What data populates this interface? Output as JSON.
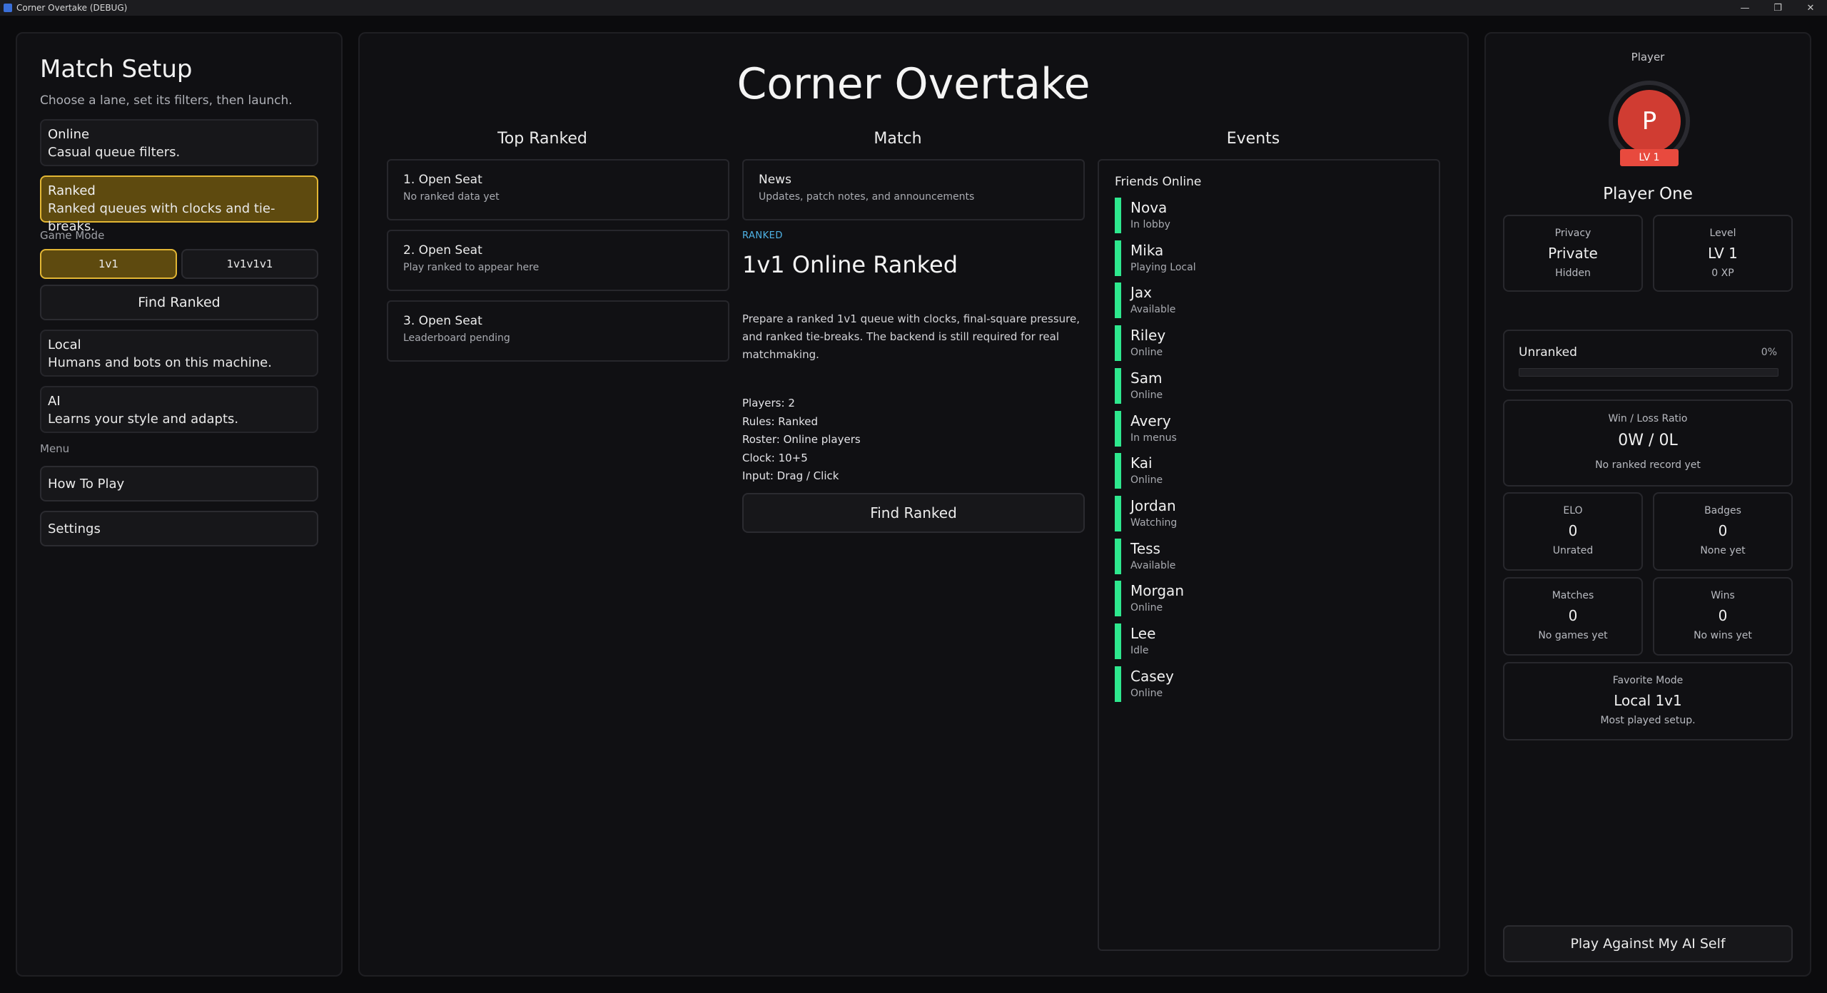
{
  "window": {
    "title": "Corner Overtake (DEBUG)",
    "min_glyph": "—",
    "max_glyph": "❐",
    "close_glyph": "✕"
  },
  "left": {
    "title": "Match Setup",
    "subtitle": "Choose a lane, set its filters, then launch.",
    "lanes": [
      {
        "name": "Online",
        "desc": "Casual queue filters."
      },
      {
        "name": "Ranked",
        "desc": "Ranked queues with clocks and tie-breaks."
      },
      {
        "name": "Local",
        "desc": "Humans and bots on this machine."
      },
      {
        "name": "AI",
        "desc": "Learns your style and adapts."
      }
    ],
    "game_mode_label": "Game Mode",
    "modes": [
      "1v1",
      "1v1v1v1"
    ],
    "selected_mode": "1v1",
    "find_button": "Find Ranked",
    "menu_label": "Menu",
    "menu": [
      "How To Play",
      "Settings"
    ]
  },
  "center": {
    "title": "Corner Overtake",
    "col_headers": [
      "Top Ranked",
      "Match",
      "Events"
    ],
    "top_ranked": [
      {
        "title": "1. Open Seat",
        "sub": "No ranked data yet"
      },
      {
        "title": "2. Open Seat",
        "sub": "Play ranked to appear here"
      },
      {
        "title": "3. Open Seat",
        "sub": "Leaderboard pending"
      }
    ],
    "news": {
      "title": "News",
      "sub": "Updates, patch notes, and announcements"
    },
    "match": {
      "tag": "RANKED",
      "title": "1v1 Online Ranked",
      "description": "Prepare a ranked 1v1 queue with clocks, final-square pressure, and ranked tie-breaks. The backend is still required for real matchmaking.",
      "players": "Players: 2",
      "rules": "Rules: Ranked",
      "roster": "Roster: Online players",
      "clock": "Clock: 10+5",
      "input": "Input: Drag / Click",
      "button": "Find Ranked"
    },
    "friends": {
      "header": "Friends Online",
      "status_color": "#2ee88e",
      "list": [
        {
          "name": "Nova",
          "status": "In lobby"
        },
        {
          "name": "Mika",
          "status": "Playing Local"
        },
        {
          "name": "Jax",
          "status": "Available"
        },
        {
          "name": "Riley",
          "status": "Online"
        },
        {
          "name": "Sam",
          "status": "Online"
        },
        {
          "name": "Avery",
          "status": "In menus"
        },
        {
          "name": "Kai",
          "status": "Online"
        },
        {
          "name": "Jordan",
          "status": "Watching"
        },
        {
          "name": "Tess",
          "status": "Available"
        },
        {
          "name": "Morgan",
          "status": "Online"
        },
        {
          "name": "Lee",
          "status": "Idle"
        },
        {
          "name": "Casey",
          "status": "Online"
        }
      ]
    }
  },
  "right": {
    "label": "Player",
    "avatar_letter": "P",
    "level_badge": "LV 1",
    "name": "Player One",
    "privacy": {
      "label": "Privacy",
      "value": "Private",
      "sub": "Hidden"
    },
    "level": {
      "label": "Level",
      "value": "LV 1",
      "sub": "0 XP"
    },
    "rank": {
      "label": "Unranked",
      "percent_text": "0%",
      "progress": 0
    },
    "winloss": {
      "label": "Win / Loss Ratio",
      "value": "0W / 0L",
      "sub": "No ranked record yet"
    },
    "elo": {
      "label": "ELO",
      "value": "0",
      "sub": "Unrated"
    },
    "badges": {
      "label": "Badges",
      "value": "0",
      "sub": "None yet"
    },
    "matches": {
      "label": "Matches",
      "value": "0",
      "sub": "No games yet"
    },
    "wins": {
      "label": "Wins",
      "value": "0",
      "sub": "No wins yet"
    },
    "favorite": {
      "label": "Favorite Mode",
      "value": "Local 1v1",
      "sub": "Most played setup."
    },
    "ai_button": "Play Against My AI Self"
  }
}
